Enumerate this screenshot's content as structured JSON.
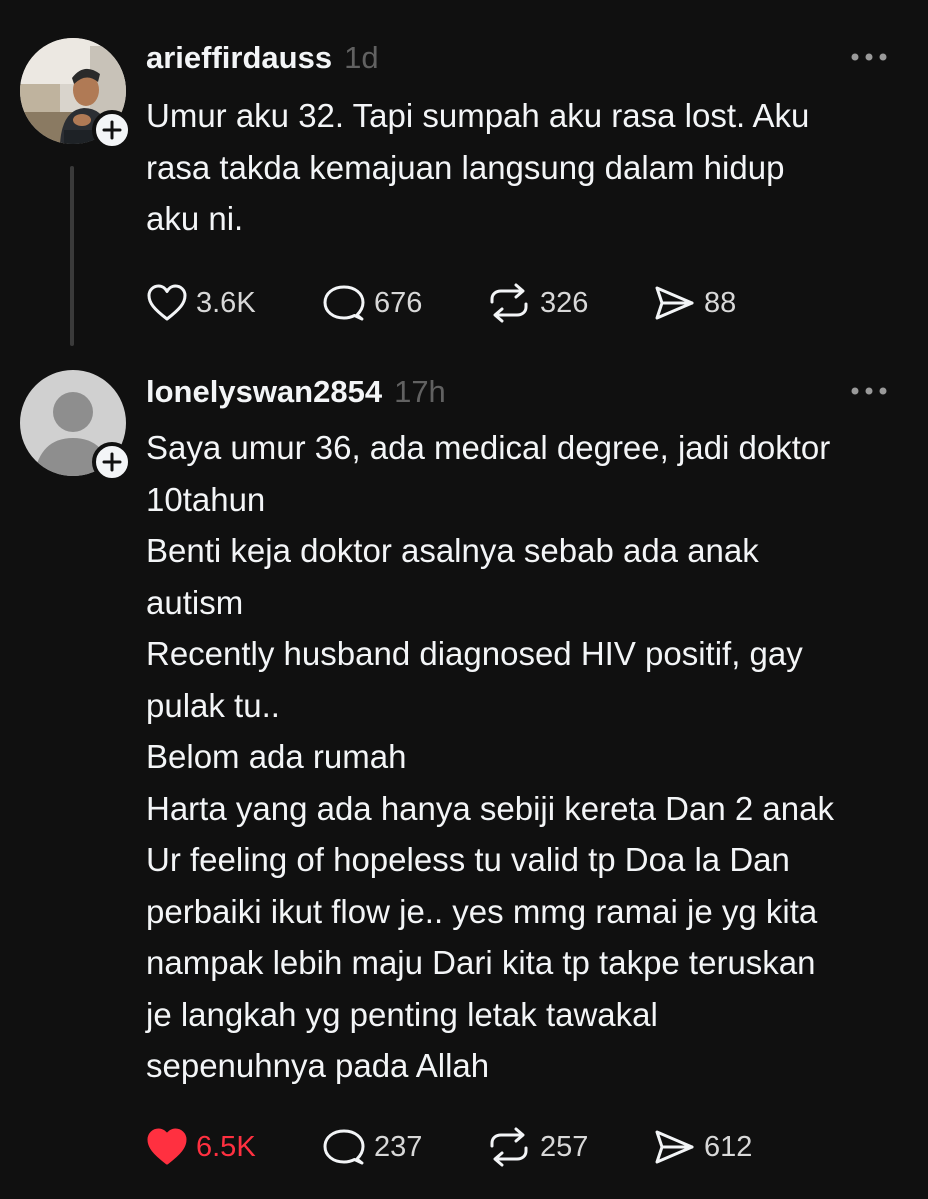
{
  "posts": [
    {
      "username": "arieffirdauss",
      "time": "1d",
      "text": "Umur aku 32. Tapi sumpah aku rasa lost. Aku\nrasa takda kemajuan langsung dalam hidup\naku ni.",
      "likes": "3.6K",
      "liked": false,
      "replies": "676",
      "reposts": "326",
      "shares": "88"
    },
    {
      "username": "lonelyswan2854",
      "time": "17h",
      "text": "Saya umur 36, ada medical degree, jadi doktor\n10tahun\nBenti keja doktor asalnya sebab ada anak\nautism\nRecently husband diagnosed HIV positif, gay\npulak tu..\nBelom ada rumah\nHarta yang ada hanya sebiji kereta Dan 2 anak\nUr feeling of hopeless tu valid tp Doa la Dan\nperbaiki ikut flow je.. yes mmg ramai je yg kita\nnampak lebih maju Dari kita tp takpe teruskan\nje langkah yg penting letak tawakal\nsepenuhnya pada Allah",
      "likes": "6.5K",
      "liked": true,
      "replies": "237",
      "reposts": "257",
      "shares": "612"
    }
  ],
  "icons": {
    "like": "heart-icon",
    "reply": "comment-icon",
    "repost": "repost-icon",
    "share": "share-icon",
    "more": "more-options-icon",
    "follow": "plus-icon"
  },
  "colors": {
    "background": "#101010",
    "text": "#f3f5f7",
    "muted": "#616161",
    "liked": "#ff3040"
  }
}
